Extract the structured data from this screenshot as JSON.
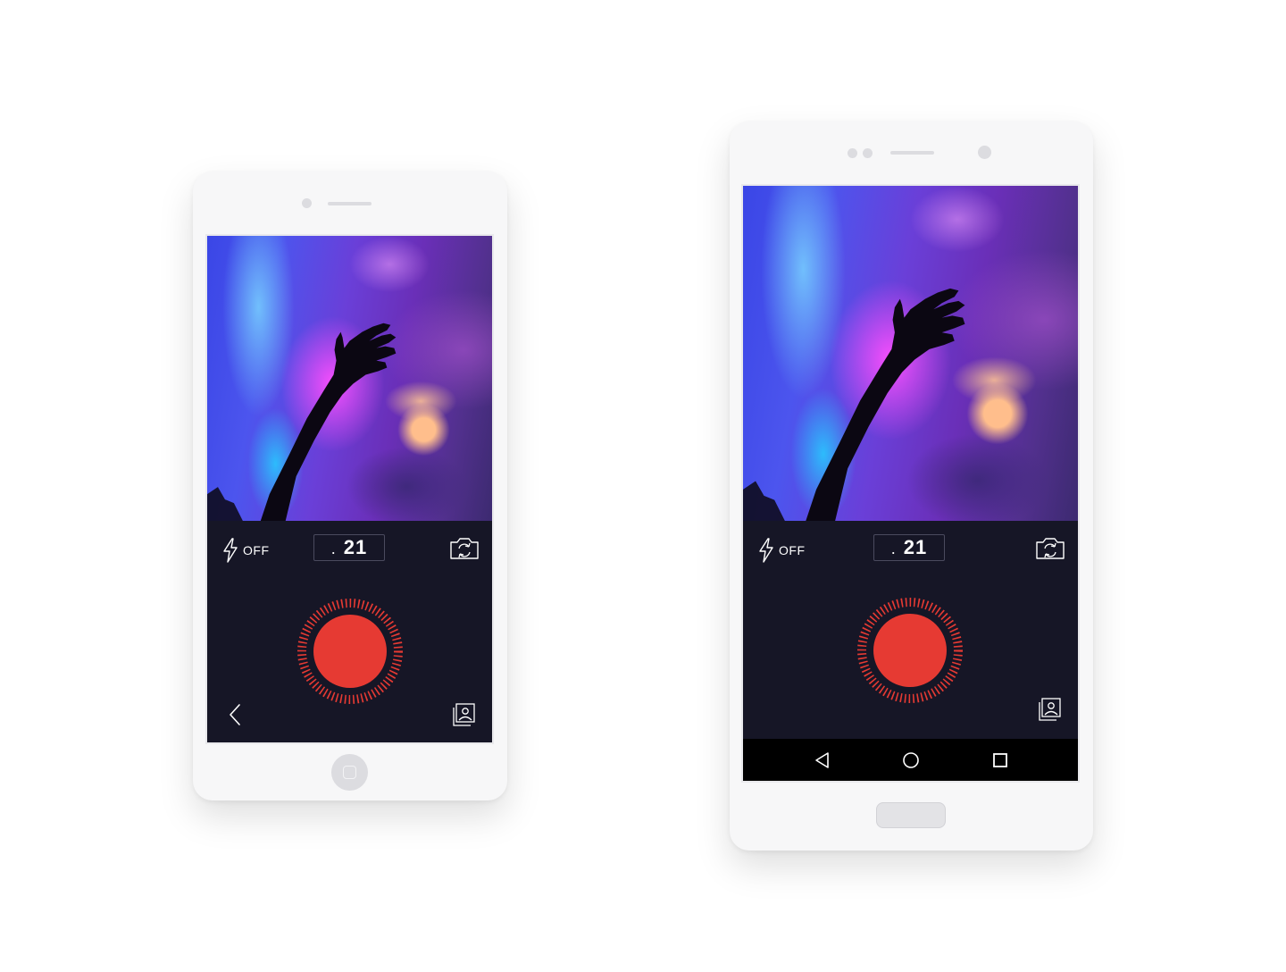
{
  "camera": {
    "flash_label": "OFF",
    "timer_dot": ".",
    "timer_value": "21"
  },
  "colors": {
    "shutter": "#e63a33",
    "control_bg": "#161626",
    "nav_bar": "#000000",
    "device_shell": "#f7f7f8"
  },
  "icons": {
    "flash": "lightning-bolt-icon",
    "switch_camera": "camera-rotate-icon",
    "gallery": "gallery-icon",
    "back": "chevron-left-icon",
    "nav_back": "triangle-back-icon",
    "nav_home": "circle-home-icon",
    "nav_recents": "square-recents-icon"
  }
}
